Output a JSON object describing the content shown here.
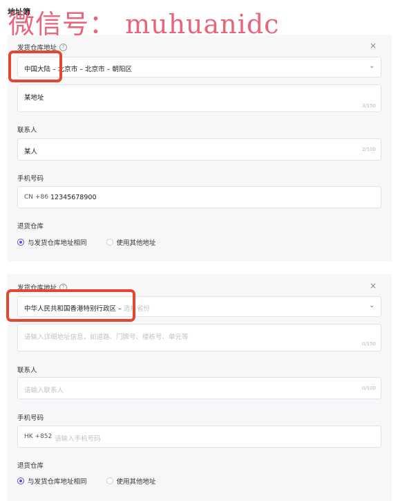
{
  "watermark": "微信号： muhuanidc",
  "page_title": "地址簿",
  "cards": [
    {
      "warehouse_label": "发货仓库地址",
      "help_icon": "?",
      "close_icon": "×",
      "region": "中国大陆 – 北京市 – 北京市 – 朝阳区",
      "region_placeholder": "",
      "address_value": "某地址",
      "address_counter": "3/150",
      "contact_label": "联系人",
      "contact_value": "某人",
      "contact_counter": "2/100",
      "phone_label": "手机号码",
      "phone_prefix": "CN +86",
      "phone_value": "12345678900",
      "return_label": "退货仓库",
      "return_options": [
        "与发货仓库地址相同",
        "使用其他地址"
      ],
      "return_selected": 0
    },
    {
      "warehouse_label": "发货仓库地址",
      "help_icon": "?",
      "close_icon": "×",
      "region": "中华人民共和国香港特别行政区 –",
      "region_placeholder": "选择省份",
      "address_placeholder": "请输入详细地址信息，如道路、门牌号、楼栋号、单元等",
      "address_counter": "0/150",
      "contact_label": "联系人",
      "contact_placeholder": "请输入联系人",
      "contact_counter": "0/100",
      "phone_label": "手机号码",
      "phone_prefix": "HK +852",
      "phone_placeholder": "请输入手机号码",
      "return_label": "退货仓库",
      "return_options": [
        "与发货仓库地址相同",
        "使用其他地址"
      ],
      "return_selected": 0
    }
  ],
  "colors": {
    "accent": "#5b4bd6",
    "highlight_annotation": "#e2472f",
    "card_bg": "#f7f7f9"
  }
}
